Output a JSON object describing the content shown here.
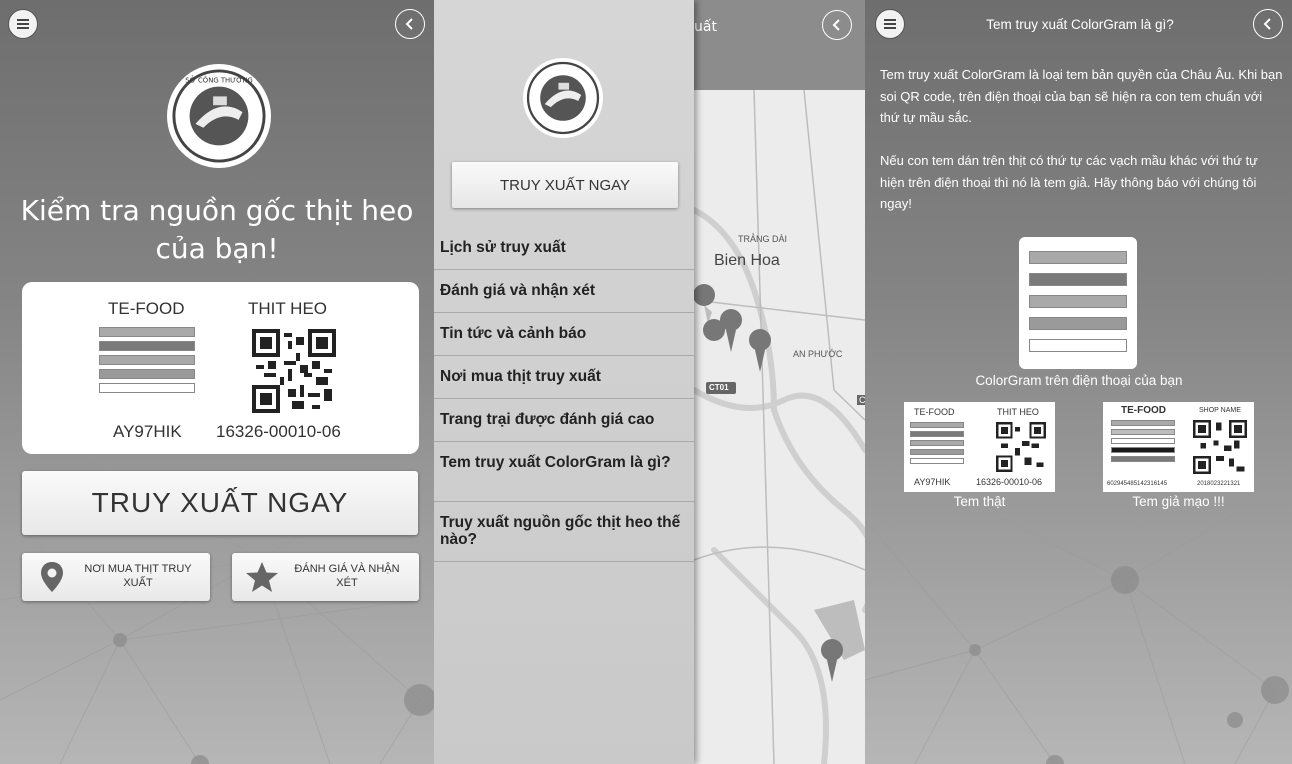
{
  "panel1": {
    "title": "Kiểm tra nguồn gốc thịt heo của bạn!",
    "card": {
      "brand": "TE-FOOD",
      "product": "THIT HEO",
      "code_left": "AY97HIK",
      "code_right": "16326-00010-06"
    },
    "main_button": "TRUY XUẤT NGAY",
    "where_to_buy": "NƠI MUA THỊT TRUY XUẤT",
    "rate_review": "ĐÁNH GIÁ VÀ NHẬN XÉT",
    "icons": {
      "menu": "menu-icon",
      "back": "back-icon",
      "pin": "map-pin-icon",
      "star": "star-icon"
    }
  },
  "panel2": {
    "drawer_button": "TRUY XUẤT NGAY",
    "menu_items": [
      "Lịch sử truy xuất",
      "Đánh giá và nhận xét",
      "Tin tức và cảnh báo",
      "Nơi mua thịt truy xuất",
      "Trang trại được đánh giá cao",
      "Tem truy xuất ColorGram là gì?",
      "Truy xuất nguồn gốc thịt heo thế nào?"
    ],
    "map_header_partial": "uất",
    "map_labels": {
      "trang_dai": "TRẢNG DÀI",
      "bien_hoa": "Bien Hoa",
      "an_phuoc": "AN PHƯỚC",
      "road": "CT01",
      "edge": "C"
    }
  },
  "panel3": {
    "title": "Tem truy xuất ColorGram là gì?",
    "para1": "Tem truy xuất ColorGram là loại tem bản quyền của Châu Âu. Khi bạn soi QR code, trên điện thoại của bạn sẽ hiện ra con tem chuẩn với thứ tự mầu sắc.",
    "para2": "Nếu con tem dán trên thịt có thứ tự các vạch mầu khác với thứ tự hiện trên điện thoại thì nó là tem giả. Hãy thông báo với chúng tôi ngay!",
    "phone_caption": "ColorGram trên điện thoại của bạn",
    "real": {
      "brand": "TE-FOOD",
      "product": "THIT HEO",
      "code_left": "AY97HIK",
      "code_right": "16326-00010-06",
      "caption": "Tem thật"
    },
    "fake": {
      "brand": "TE-FOOD",
      "shop": "SHOP NAME",
      "code_left": "602945485142316145",
      "code_right": "2018023221321",
      "caption": "Tem giả mạo !!!"
    }
  },
  "colors": {
    "bar_light": "#a9a9a9",
    "bar_dark": "#7a7a7a",
    "bar_mid": "#9a9a9a",
    "bar_black": "#1a1a1a",
    "bar_white": "#ffffff"
  }
}
